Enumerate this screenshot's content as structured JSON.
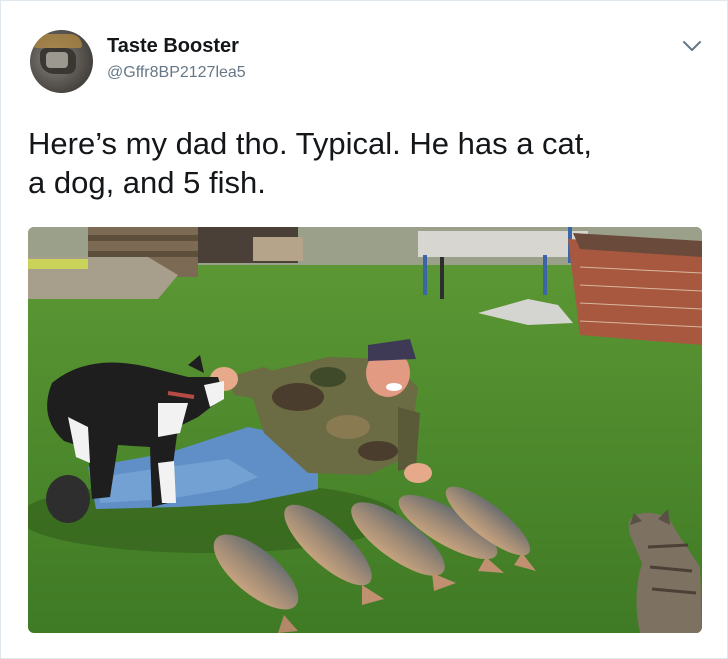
{
  "tweet": {
    "author": {
      "display_name": "Taste Booster",
      "handle": "@Gffr8BP2127lea5",
      "avatar_icon": "profile-photo"
    },
    "menu_icon": "chevron-down-icon",
    "text_line1": "Here’s my dad tho. Typical. He has a cat,",
    "text_line2": "a dog, and 5 fish.",
    "photo": {
      "subjects": [
        "man",
        "dog",
        "cat",
        "fish"
      ],
      "fish_count": 5
    }
  },
  "colors": {
    "name": "#14171a",
    "handle": "#657786",
    "chevron": "#657786",
    "grass": "#4f8a2e"
  }
}
